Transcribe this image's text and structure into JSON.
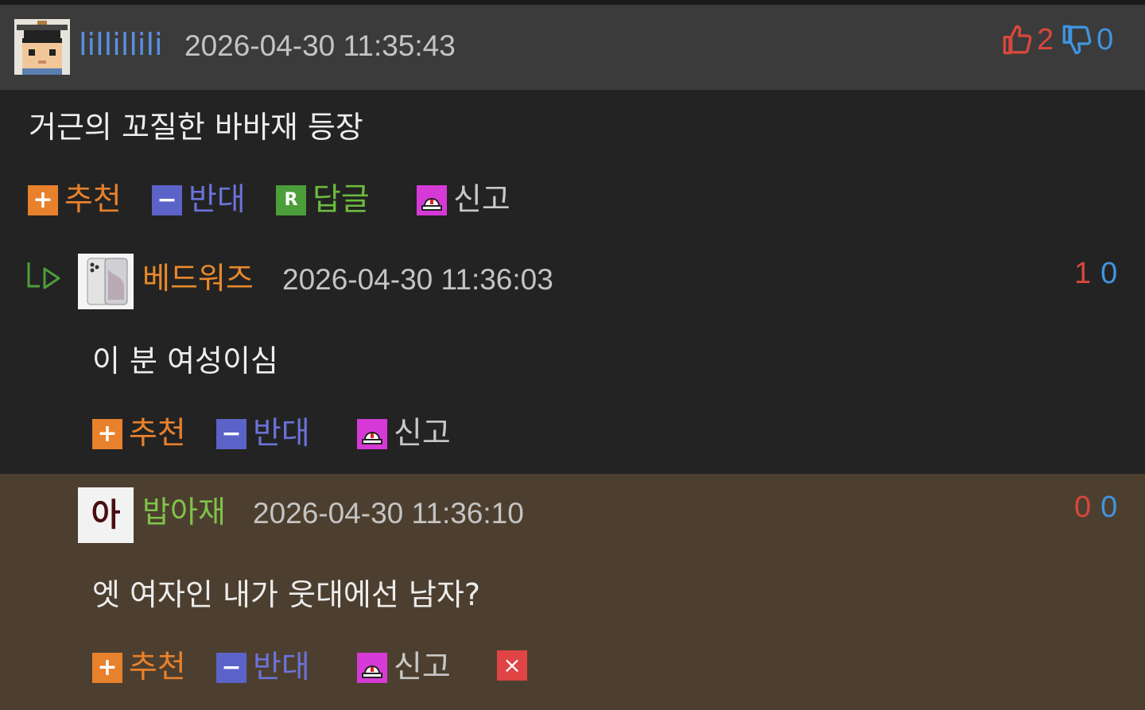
{
  "colors": {
    "header_bg": "#3b3b3b",
    "body_bg": "#232323",
    "highlight_bg": "#4d3f2f",
    "nick_blue": "#5a8fe0",
    "nick_orange": "#e8892c",
    "nick_green": "#7fc24a",
    "up_red": "#d9473d",
    "down_blue": "#3f95e0",
    "recommend": "#e8812c",
    "oppose": "#6b73d9",
    "reply": "#6cbb3f",
    "report": "#c8c8c8"
  },
  "comments": [
    {
      "nickname": "lillillili",
      "datetime": "2026-04-30 11:35:43",
      "upvotes": "2",
      "downvotes": "0",
      "content": "거근의 꼬질한 바바재 등장",
      "actions": {
        "recommend": "추천",
        "oppose": "반대",
        "reply": "답글",
        "report": "신고"
      },
      "icons": {
        "avatar": "pixel-character-avatar",
        "up": "thumbs-up-icon",
        "down": "thumbs-down-icon"
      }
    },
    {
      "nickname": "베드워즈",
      "datetime": "2026-04-30 11:36:03",
      "upvotes": "1",
      "downvotes": "0",
      "content": "이 분 여성이심",
      "actions": {
        "recommend": "추천",
        "oppose": "반대",
        "report": "신고"
      },
      "icons": {
        "reply_arrow": "reply-arrow-icon",
        "avatar": "phone-photo-avatar"
      }
    },
    {
      "nickname": "밥아재",
      "avatar_text": "아",
      "datetime": "2026-04-30 11:36:10",
      "upvotes": "0",
      "downvotes": "0",
      "content": "엣 여자인 내가 웃대에선 남자?",
      "actions": {
        "recommend": "추천",
        "oppose": "반대",
        "report": "신고",
        "delete": "×"
      },
      "icons": {
        "avatar": "text-avatar"
      }
    }
  ]
}
